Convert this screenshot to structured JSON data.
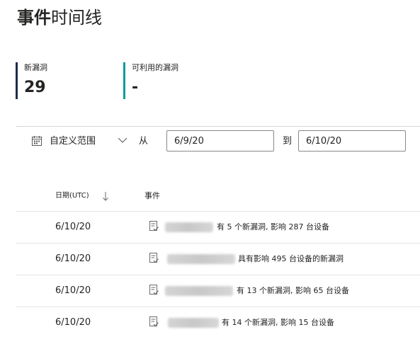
{
  "header": {
    "title_bold": "事件",
    "title_rest": "时间线"
  },
  "cards": [
    {
      "label": "新漏洞",
      "value": "29",
      "accent": "#1b2a4e"
    },
    {
      "label": "可利用的漏洞",
      "value": "-",
      "accent": "#0f9b9b"
    }
  ],
  "filter": {
    "range_label": "自定义范围",
    "from_label": "从",
    "from_value": "6/9/20",
    "to_label": "到",
    "to_value": "6/10/20",
    "icons": {
      "calendar": "calendar-icon",
      "dropdown": "chevron-down-icon"
    }
  },
  "table": {
    "headers": {
      "date": "日期(UTC)",
      "event": "事件"
    },
    "sort_icon": "arrow-down-icon",
    "rows": [
      {
        "date": "6/10/20",
        "text": "有 5 个新漏洞, 影响 287 台设备"
      },
      {
        "date": "6/10/20",
        "text": "具有影响 495 台设备的新漏洞"
      },
      {
        "date": "6/10/20",
        "text": "有 13 个新漏洞, 影响 65 台设备"
      },
      {
        "date": "6/10/20",
        "text": "有 14 个新漏洞, 影响 15 台设备"
      }
    ]
  }
}
